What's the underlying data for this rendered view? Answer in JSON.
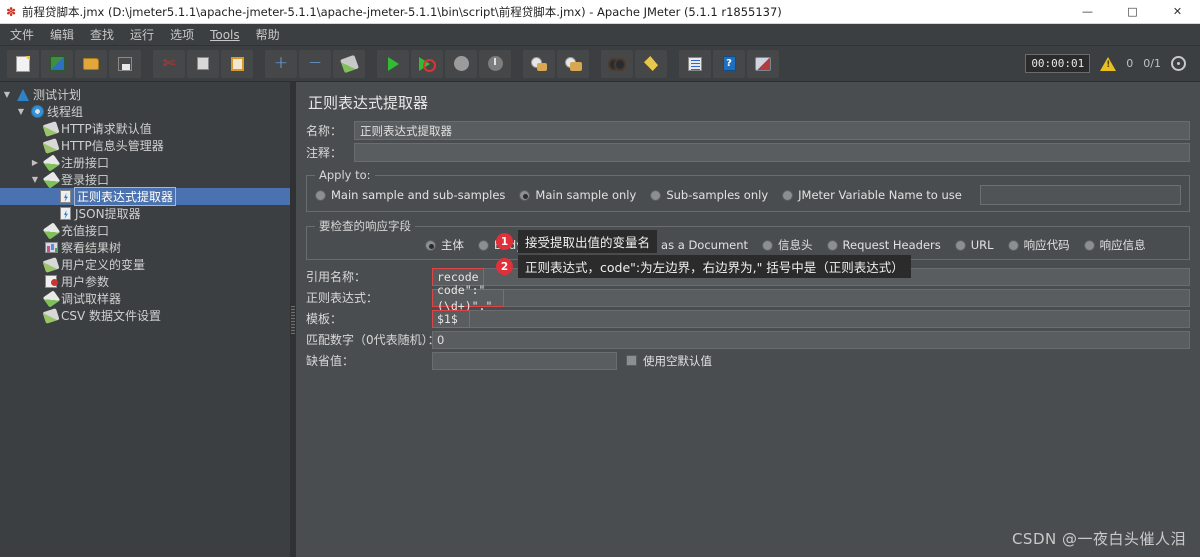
{
  "window": {
    "title": "前程贷脚本.jmx (D:\\jmeter5.1.1\\apache-jmeter-5.1.1\\apache-jmeter-5.1.1\\bin\\script\\前程贷脚本.jmx) - Apache JMeter (5.1.1 r1855137)",
    "app_icon": "jmeter-feather-icon",
    "minimize": "—",
    "maximize": "□",
    "close": "✕"
  },
  "menubar": {
    "items": [
      {
        "label": "文件",
        "name": "menu-file"
      },
      {
        "label": "编辑",
        "name": "menu-edit"
      },
      {
        "label": "查找",
        "name": "menu-search"
      },
      {
        "label": "运行",
        "name": "menu-run"
      },
      {
        "label": "选项",
        "name": "menu-options"
      },
      {
        "label": "Tools",
        "name": "menu-tools",
        "underlined": true
      },
      {
        "label": "帮助",
        "name": "menu-help"
      }
    ]
  },
  "toolbar": {
    "buttons": [
      {
        "name": "new-button",
        "icon": "new-document-icon"
      },
      {
        "name": "templates-button",
        "icon": "templates-icon"
      },
      {
        "name": "open-button",
        "icon": "open-folder-icon"
      },
      {
        "name": "save-button",
        "icon": "save-disk-icon"
      },
      {
        "name": "cut-button",
        "icon": "scissors-icon"
      },
      {
        "name": "copy-button",
        "icon": "copy-icon"
      },
      {
        "name": "paste-button",
        "icon": "clipboard-paste-icon"
      },
      {
        "name": "expand-button",
        "icon": "plus-icon"
      },
      {
        "name": "collapse-button",
        "icon": "minus-icon"
      },
      {
        "name": "toggle-button",
        "icon": "toggle-icon"
      },
      {
        "name": "start-button",
        "icon": "run-play-icon"
      },
      {
        "name": "start-no-pauses-button",
        "icon": "run-no-pauses-icon"
      },
      {
        "name": "stop-button",
        "icon": "stop-circle-icon"
      },
      {
        "name": "shutdown-button",
        "icon": "shutdown-icon"
      },
      {
        "name": "clear-button",
        "icon": "clear-broom-icon"
      },
      {
        "name": "clear-all-button",
        "icon": "clear-all-broom-icon"
      },
      {
        "name": "search-button",
        "icon": "binoculars-search-icon"
      },
      {
        "name": "reset-search-button",
        "icon": "reset-search-icon"
      },
      {
        "name": "log-viewer-button",
        "icon": "log-list-icon"
      },
      {
        "name": "help-button",
        "icon": "help-book-icon"
      },
      {
        "name": "function-helper-button",
        "icon": "function-helper-icon"
      }
    ],
    "status": {
      "timer": "00:00:01",
      "warning_count": "0",
      "thread_counts": "0/1",
      "warning_icon": "warning-triangle-icon",
      "connections_icon": "connections-icon"
    }
  },
  "tree": {
    "nodes": [
      {
        "label": "测试计划",
        "indent": 0,
        "twisty": "▼",
        "icon": "test-plan-icon",
        "name": "tree-node-test-plan"
      },
      {
        "label": "线程组",
        "indent": 1,
        "twisty": "▼",
        "icon": "thread-group-icon",
        "name": "tree-node-thread-group"
      },
      {
        "label": "HTTP请求默认值",
        "indent": 2,
        "twisty": "",
        "icon": "config-element-icon",
        "name": "tree-node-http-defaults"
      },
      {
        "label": "HTTP信息头管理器",
        "indent": 2,
        "twisty": "",
        "icon": "config-element-icon",
        "name": "tree-node-http-header-manager"
      },
      {
        "label": "注册接口",
        "indent": 2,
        "twisty": "▶",
        "icon": "sampler-icon",
        "name": "tree-node-register-api"
      },
      {
        "label": "登录接口",
        "indent": 2,
        "twisty": "▼",
        "icon": "sampler-icon",
        "name": "tree-node-login-api"
      },
      {
        "label": "正则表达式提取器",
        "indent": 3,
        "twisty": "",
        "icon": "post-processor-icon",
        "name": "tree-node-regex-extractor",
        "selected": true
      },
      {
        "label": "JSON提取器",
        "indent": 3,
        "twisty": "",
        "icon": "post-processor-icon",
        "name": "tree-node-json-extractor"
      },
      {
        "label": "充值接口",
        "indent": 2,
        "twisty": "",
        "icon": "sampler-icon",
        "name": "tree-node-recharge-api"
      },
      {
        "label": "察看结果树",
        "indent": 2,
        "twisty": "",
        "icon": "listener-icon",
        "name": "tree-node-view-results-tree"
      },
      {
        "label": "用户定义的变量",
        "indent": 2,
        "twisty": "",
        "icon": "config-element-icon",
        "name": "tree-node-user-defined-variables"
      },
      {
        "label": "用户参数",
        "indent": 2,
        "twisty": "",
        "icon": "user-parameters-icon",
        "name": "tree-node-user-parameters"
      },
      {
        "label": "调试取样器",
        "indent": 2,
        "twisty": "",
        "icon": "sampler-icon",
        "name": "tree-node-debug-sampler"
      },
      {
        "label": "CSV 数据文件设置",
        "indent": 2,
        "twisty": "",
        "icon": "config-element-icon",
        "name": "tree-node-csv-data-set"
      }
    ]
  },
  "panel": {
    "title": "正则表达式提取器",
    "name_label": "名称：",
    "name_value": "正则表达式提取器",
    "comment_label": "注释：",
    "comment_value": "",
    "apply_to": {
      "legend": "Apply to:",
      "options": [
        {
          "label": "Main sample and sub-samples",
          "selected": false,
          "name": "radio-main-and-sub-samples"
        },
        {
          "label": "Main sample only",
          "selected": true,
          "name": "radio-main-sample-only"
        },
        {
          "label": "Sub-samples only",
          "selected": false,
          "name": "radio-sub-samples-only"
        },
        {
          "label": "JMeter Variable Name to use",
          "selected": false,
          "name": "radio-jmeter-variable-name"
        }
      ],
      "variable_value": ""
    },
    "response_field": {
      "legend": "要检查的响应字段",
      "options": [
        {
          "label": "主体",
          "selected": true,
          "name": "radio-body"
        },
        {
          "label": "Body (unescaped)",
          "selected": false,
          "name": "radio-body-unescaped"
        },
        {
          "label": "Body as a Document",
          "selected": false,
          "name": "radio-body-as-document"
        },
        {
          "label": "信息头",
          "selected": false,
          "name": "radio-response-headers"
        },
        {
          "label": "Request Headers",
          "selected": false,
          "name": "radio-request-headers"
        },
        {
          "label": "URL",
          "selected": false,
          "name": "radio-url"
        },
        {
          "label": "响应代码",
          "selected": false,
          "name": "radio-response-code"
        },
        {
          "label": "响应信息",
          "selected": false,
          "name": "radio-response-message"
        }
      ]
    },
    "fields": {
      "refname_label": "引用名称：",
      "refname_value": "recode",
      "regex_label": "正则表达式：",
      "regex_value": "code\":\"(\\d+)\",\"",
      "template_label": "模板：",
      "template_value": "$1$",
      "matchno_label": "匹配数字（0代表随机）：",
      "matchno_value": "0",
      "default_label": "缺省值：",
      "default_value": "",
      "use_empty_default_label": "使用空默认值",
      "use_empty_default_checked": false
    }
  },
  "annotations": [
    {
      "number": "1",
      "text": "接受提取出值的变量名",
      "name": "annotation-refname"
    },
    {
      "number": "2",
      "text": "正则表达式，code\":为左边界，右边界为,\"  括号中是（正则表达式）",
      "name": "annotation-regex"
    }
  ],
  "watermark": "CSDN @一夜白头催人泪",
  "colors": {
    "selection_blue": "#4a72b0",
    "panel_bg": "#4a4d4f",
    "chrome_bg": "#3c3f41",
    "annotation_red": "#e0303a",
    "highlight_border": "#d44"
  }
}
